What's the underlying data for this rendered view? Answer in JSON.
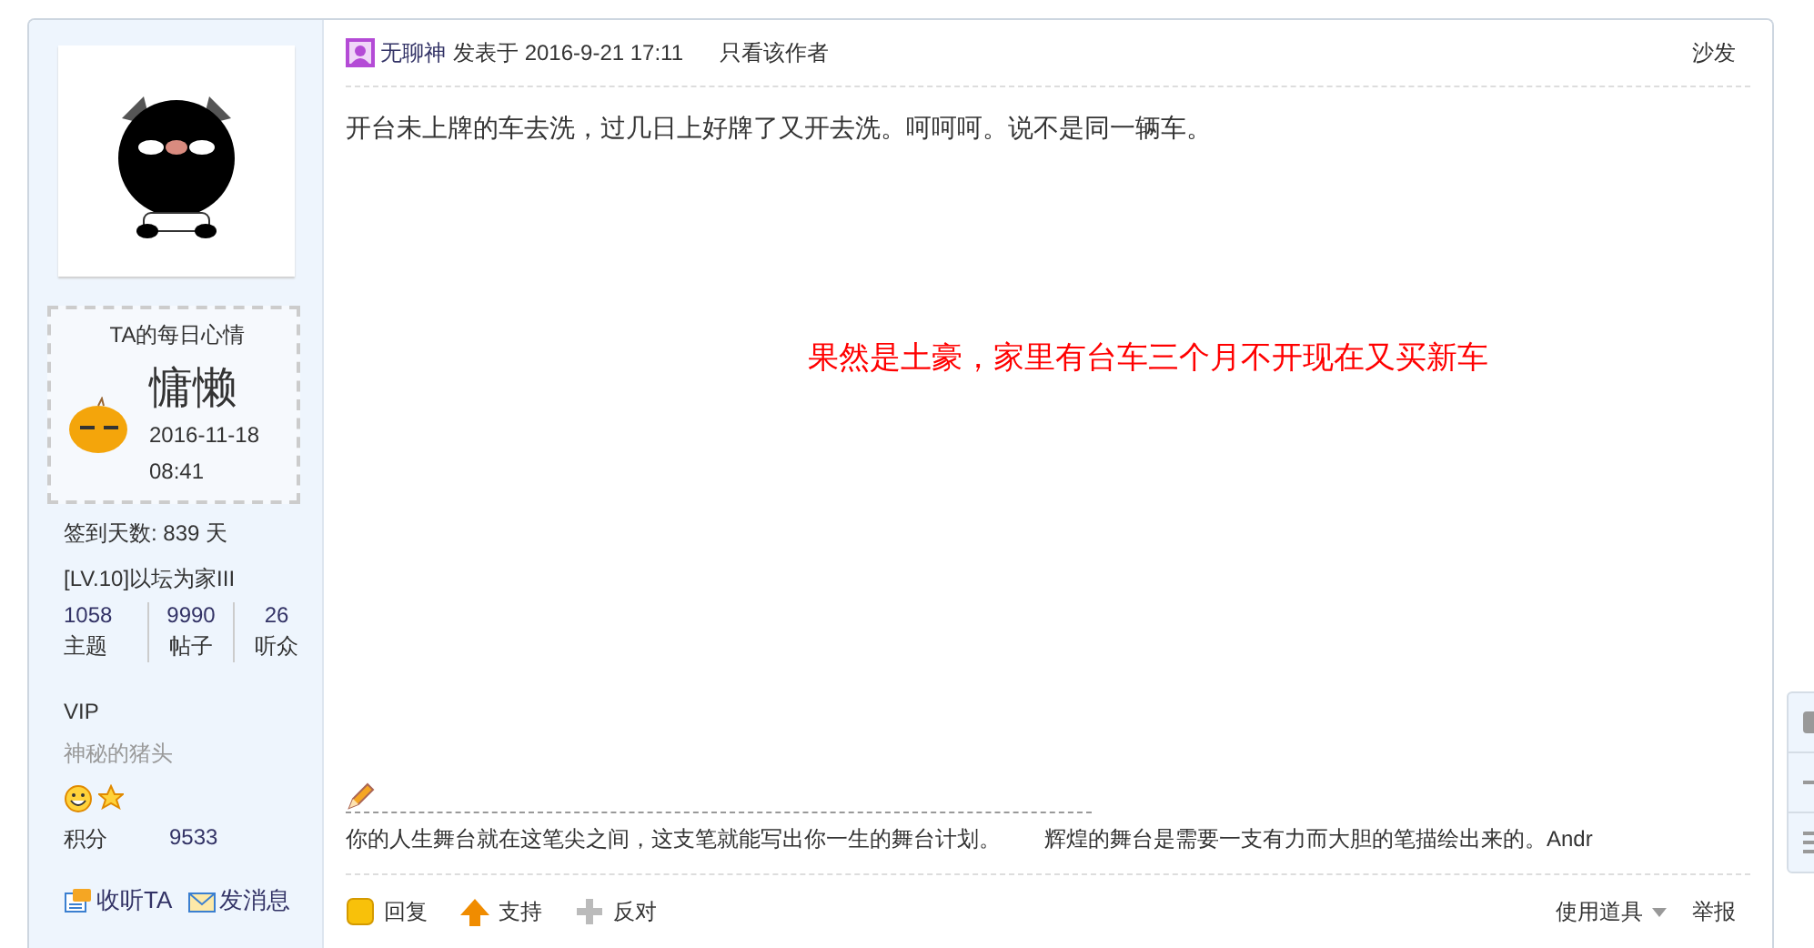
{
  "sidebar": {
    "mood": {
      "title": "TA的每日心情",
      "mood": "慵懒",
      "time": "2016-11-18 08:41"
    },
    "checkin": "签到天数: 839 天",
    "level": "[LV.10]以坛为家III",
    "stats": [
      {
        "value": "1058",
        "label": "主题"
      },
      {
        "value": "9990",
        "label": "帖子"
      },
      {
        "value": "26",
        "label": "听众"
      }
    ],
    "group": "VIP",
    "user_title": "神秘的猪头",
    "points_label": "积分",
    "points": "9533",
    "actions": [
      {
        "kind": "follow",
        "label": "收听TA"
      },
      {
        "kind": "message",
        "label": "发消息"
      }
    ]
  },
  "post": {
    "author": "无聊神",
    "posted": "发表于 2016-9-21 17:11",
    "only_author": "只看该作者",
    "floor": "沙发",
    "content": "开台未上牌的车去洗，过几日上好牌了又开去洗。呵呵呵。说不是同一辆车。",
    "highlight": "果然是土豪，家里有台车三个月不开现在又买新车",
    "signature": "你的人生舞台就在这笔尖之间，这支笔就能写出你一生的舞台计划。　　辉煌的舞台是需要一支有力而大胆的笔描绘出来的。Andr",
    "actions": [
      {
        "kind": "reply",
        "label": "回复"
      },
      {
        "kind": "support",
        "label": "支持"
      },
      {
        "kind": "oppose",
        "label": "反对"
      }
    ],
    "tools": [
      {
        "kind": "dropdown",
        "label": "使用道具"
      },
      {
        "kind": "link",
        "label": "举报"
      }
    ]
  }
}
